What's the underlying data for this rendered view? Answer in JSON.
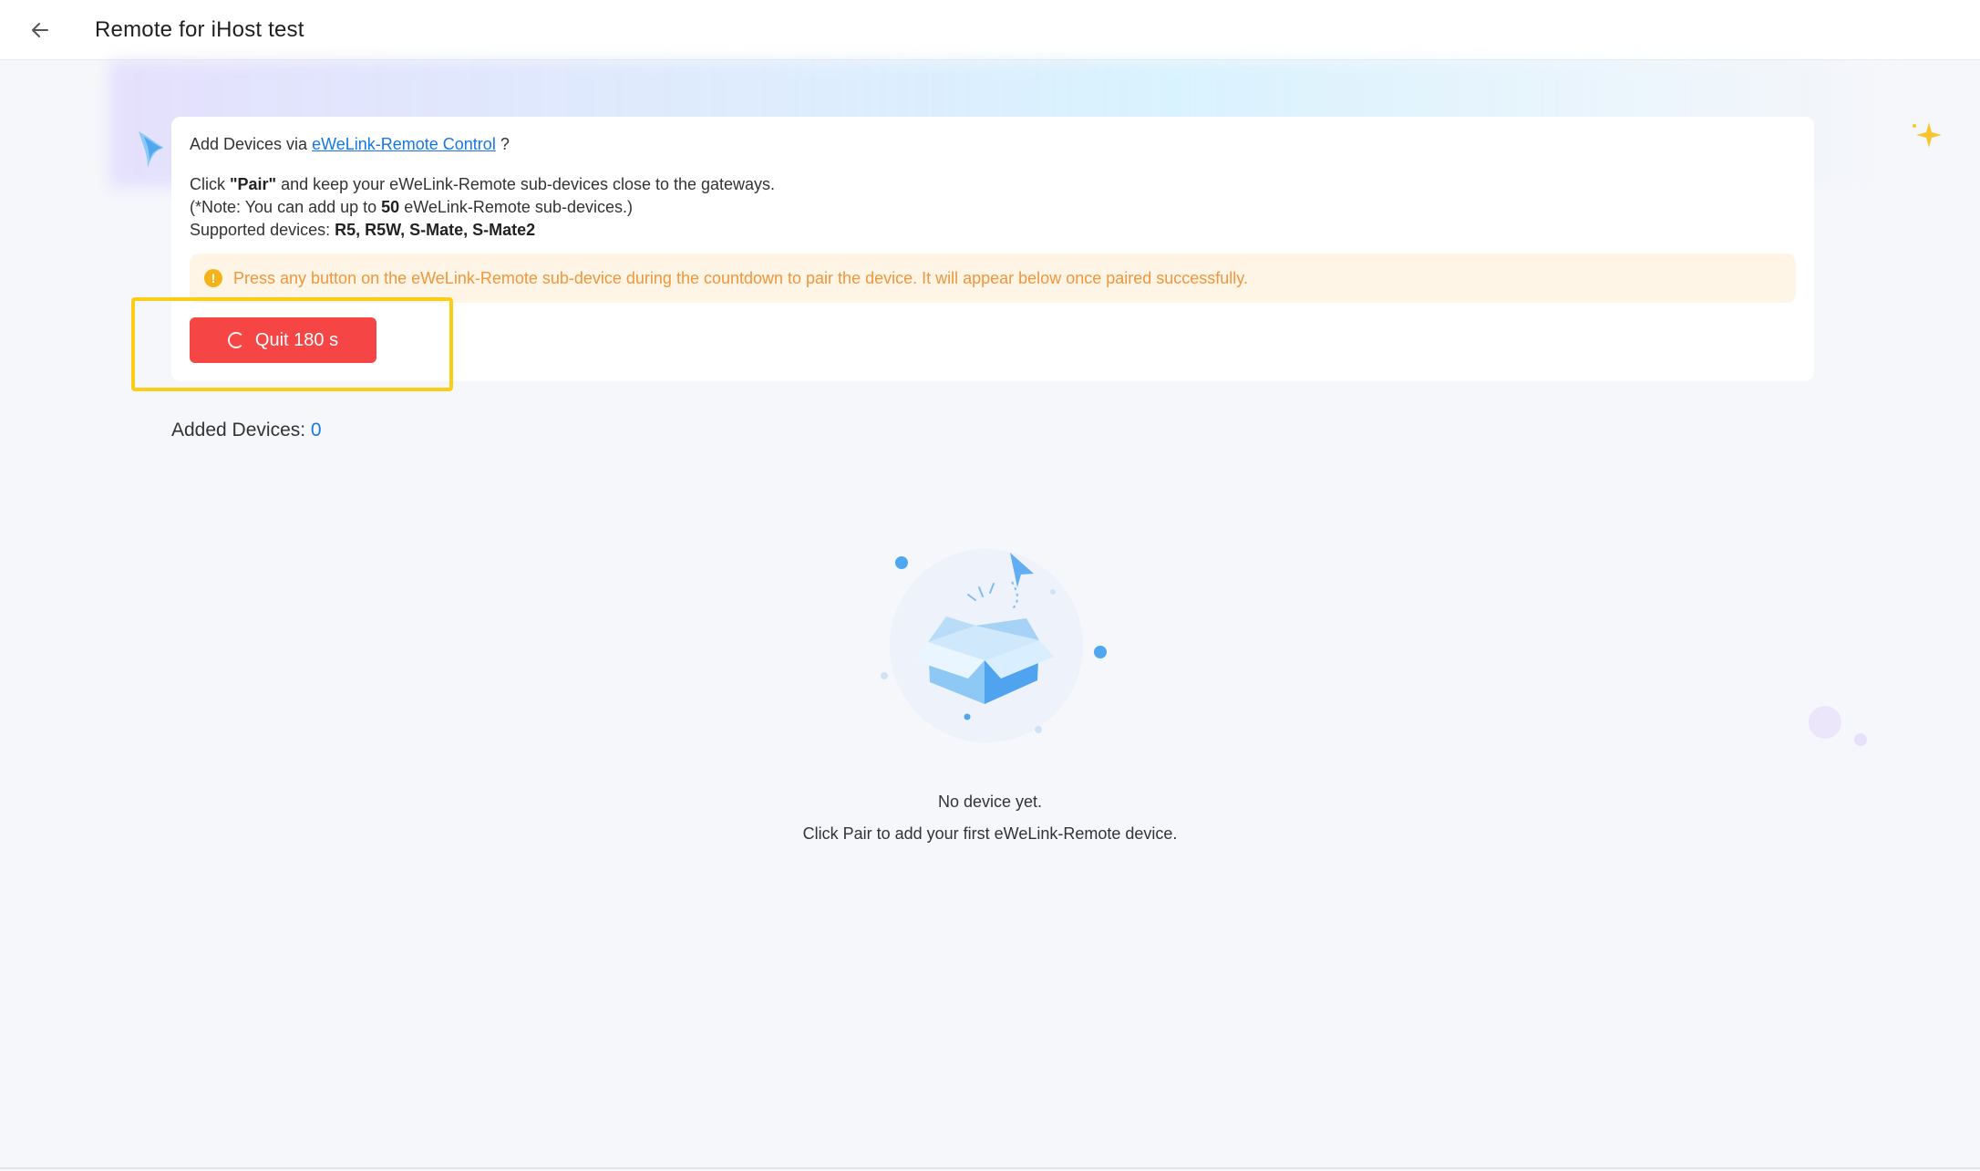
{
  "header": {
    "title": "Remote for iHost test",
    "back_icon": "arrow-left-icon"
  },
  "card": {
    "intro_prefix": "Add Devices via ",
    "intro_link": "eWeLink-Remote Control",
    "intro_suffix": " ?",
    "line1_prefix": "Click ",
    "line1_bold": "\"Pair\"",
    "line1_suffix": " and keep your eWeLink-Remote sub-devices close to the gateways.",
    "line2_prefix": "(*Note: You can add up to ",
    "line2_bold": "50",
    "line2_suffix": " eWeLink-Remote sub-devices.)",
    "line3_prefix": "Supported devices: ",
    "line3_bold": "R5, R5W, S-Mate, S-Mate2",
    "notice_icon": "!",
    "notice_text": "Press any button on the eWeLink-Remote sub-device during the countdown to pair the device. It will appear below once paired successfully.",
    "quit_button": "Quit 180 s"
  },
  "added": {
    "label": "Added Devices: ",
    "count": "0"
  },
  "empty_state": {
    "title": "No device yet.",
    "subtitle": "Click Pair to add your first eWeLink-Remote device."
  },
  "colors": {
    "accent": "#1677e6",
    "danger": "#f54545",
    "warning_text": "#f0963b",
    "warning_bg": "#fff5e6",
    "highlight": "#fbcd17"
  }
}
